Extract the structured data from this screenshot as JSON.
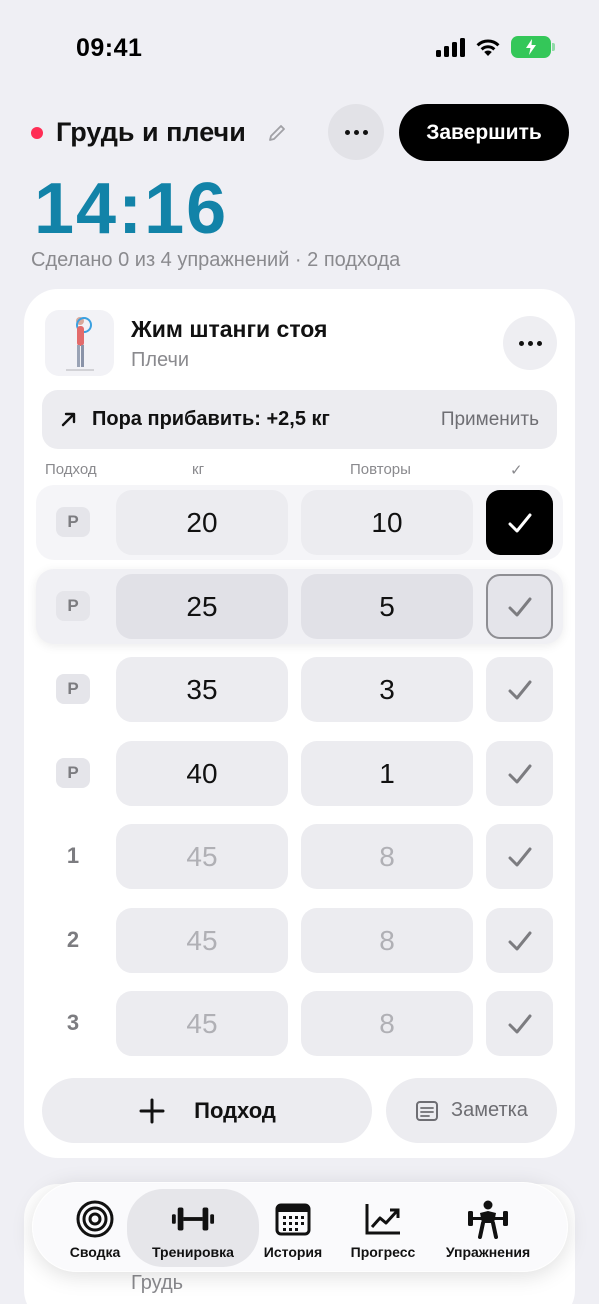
{
  "status_bar": {
    "time": "09:41"
  },
  "workout": {
    "title": "Грудь и плечи",
    "finish_label": "Завершить",
    "timer": "14:16",
    "summary": "Сделано 0 из 4 упражнений · 2 подхода"
  },
  "exercise": {
    "name": "Жим штанги стоя",
    "muscle": "Плечи",
    "suggestion": "Пора прибавить: +2,5 кг",
    "apply_label": "Применить",
    "columns": {
      "set": "Подход",
      "kg": "кг",
      "reps": "Повторы",
      "check": "✓"
    },
    "sets": [
      {
        "label": "Р",
        "type": "warmup",
        "kg": "20",
        "reps": "10",
        "state": "done"
      },
      {
        "label": "Р",
        "type": "warmup",
        "kg": "25",
        "reps": "5",
        "state": "active"
      },
      {
        "label": "Р",
        "type": "warmup",
        "kg": "35",
        "reps": "3",
        "state": "pending"
      },
      {
        "label": "Р",
        "type": "warmup",
        "kg": "40",
        "reps": "1",
        "state": "pending"
      },
      {
        "label": "1",
        "type": "working",
        "kg": "45",
        "reps": "8",
        "state": "placeholder"
      },
      {
        "label": "2",
        "type": "working",
        "kg": "45",
        "reps": "8",
        "state": "placeholder"
      },
      {
        "label": "3",
        "type": "working",
        "kg": "45",
        "reps": "8",
        "state": "placeholder"
      }
    ],
    "add_set_label": "Подход",
    "note_label": "Заметка"
  },
  "next_exercise": {
    "muscle": "Грудь"
  },
  "tabbar": {
    "items": [
      {
        "label": "Сводка",
        "icon": "target-icon"
      },
      {
        "label": "Тренировка",
        "icon": "dumbbell-icon",
        "active": true
      },
      {
        "label": "История",
        "icon": "calendar-icon"
      },
      {
        "label": "Прогресс",
        "icon": "trend-chart-icon"
      },
      {
        "label": "Упражнения",
        "icon": "weightlifter-icon"
      }
    ]
  },
  "colors": {
    "accent": "#1283a8",
    "status_dot": "#ff2d55",
    "battery": "#34c759"
  }
}
